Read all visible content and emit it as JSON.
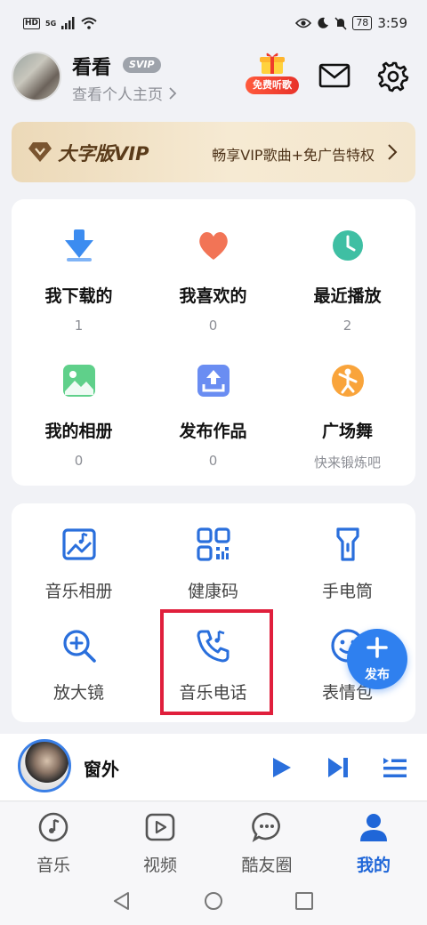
{
  "status": {
    "hd": "HD",
    "network": "5G",
    "battery": "78",
    "time": "3:59"
  },
  "profile": {
    "name": "看看",
    "badge": "SVIP",
    "link": "查看个人主页",
    "gift_label": "免费听歌"
  },
  "vip": {
    "title": "大字版VIP",
    "desc": "畅享VIP歌曲+免广告特权"
  },
  "grid": [
    {
      "label": "我下载的",
      "count": "1",
      "icon": "download-icon"
    },
    {
      "label": "我喜欢的",
      "count": "0",
      "icon": "heart-icon"
    },
    {
      "label": "最近播放",
      "count": "2",
      "icon": "clock-icon"
    },
    {
      "label": "我的相册",
      "count": "0",
      "icon": "photo-icon"
    },
    {
      "label": "发布作品",
      "count": "0",
      "icon": "upload-icon"
    },
    {
      "label": "广场舞",
      "count": "快来锻炼吧",
      "icon": "dance-icon"
    }
  ],
  "tools": [
    {
      "label": "音乐相册",
      "icon": "music-album-icon"
    },
    {
      "label": "健康码",
      "icon": "qr-code-icon"
    },
    {
      "label": "手电筒",
      "icon": "flashlight-icon"
    },
    {
      "label": "放大镜",
      "icon": "magnifier-icon"
    },
    {
      "label": "音乐电话",
      "icon": "music-phone-icon"
    },
    {
      "label": "表情包",
      "icon": "emoji-icon"
    }
  ],
  "fab": {
    "label": "发布"
  },
  "player": {
    "title": "窗外"
  },
  "tabs": [
    {
      "label": "音乐",
      "icon": "music-note-icon"
    },
    {
      "label": "视频",
      "icon": "video-play-icon"
    },
    {
      "label": "酷友圈",
      "icon": "chat-bubble-icon"
    },
    {
      "label": "我的",
      "icon": "person-icon",
      "active": true
    }
  ],
  "colors": {
    "accent": "#1f66d8",
    "highlight": "#e01f3c",
    "vip_text": "#5a3b1a"
  }
}
